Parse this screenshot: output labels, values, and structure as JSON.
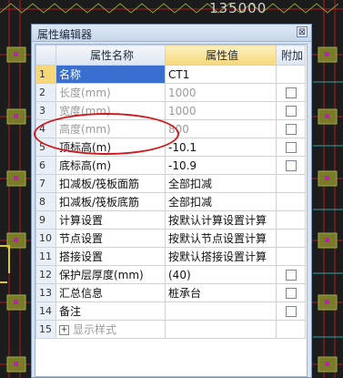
{
  "background": {
    "dimension_text": "135000"
  },
  "window": {
    "title": "属性编辑器",
    "close_glyph": "⊠"
  },
  "columns": {
    "name": "属性名称",
    "value": "属性值",
    "extra": "附加"
  },
  "rows": [
    {
      "index": "1",
      "name": "名称",
      "value": "CT1",
      "greyed": false,
      "selected": true,
      "checkbox": false
    },
    {
      "index": "2",
      "name": "长度(mm)",
      "value": "1000",
      "greyed": true,
      "selected": false,
      "checkbox": true
    },
    {
      "index": "3",
      "name": "宽度(mm)",
      "value": "1000",
      "greyed": true,
      "selected": false,
      "checkbox": true
    },
    {
      "index": "4",
      "name": "高度(mm)",
      "value": "800",
      "greyed": true,
      "selected": false,
      "checkbox": true
    },
    {
      "index": "5",
      "name": "顶标高(m)",
      "value": "-10.1",
      "greyed": false,
      "selected": false,
      "checkbox": true
    },
    {
      "index": "6",
      "name": "底标高(m)",
      "value": "-10.9",
      "greyed": false,
      "selected": false,
      "checkbox": true
    },
    {
      "index": "7",
      "name": "扣减板/筏板面筋",
      "value": "全部扣减",
      "greyed": false,
      "selected": false,
      "checkbox": false
    },
    {
      "index": "8",
      "name": "扣减板/筏板底筋",
      "value": "全部扣减",
      "greyed": false,
      "selected": false,
      "checkbox": false
    },
    {
      "index": "9",
      "name": "计算设置",
      "value": "按默认计算设置计算",
      "greyed": false,
      "selected": false,
      "checkbox": false
    },
    {
      "index": "10",
      "name": "节点设置",
      "value": "按默认节点设置计算",
      "greyed": false,
      "selected": false,
      "checkbox": false
    },
    {
      "index": "11",
      "name": "搭接设置",
      "value": "按默认搭接设置计算",
      "greyed": false,
      "selected": false,
      "checkbox": false
    },
    {
      "index": "12",
      "name": "保护层厚度(mm)",
      "value": "(40)",
      "greyed": false,
      "selected": false,
      "checkbox": true
    },
    {
      "index": "13",
      "name": "汇总信息",
      "value": "桩承台",
      "greyed": false,
      "selected": false,
      "checkbox": true
    },
    {
      "index": "14",
      "name": "备注",
      "value": "",
      "greyed": false,
      "selected": false,
      "checkbox": true
    },
    {
      "index": "15",
      "name": "显示样式",
      "value": "",
      "greyed": true,
      "selected": false,
      "checkbox": false,
      "expandable": true,
      "expand_glyph": "+"
    }
  ]
}
